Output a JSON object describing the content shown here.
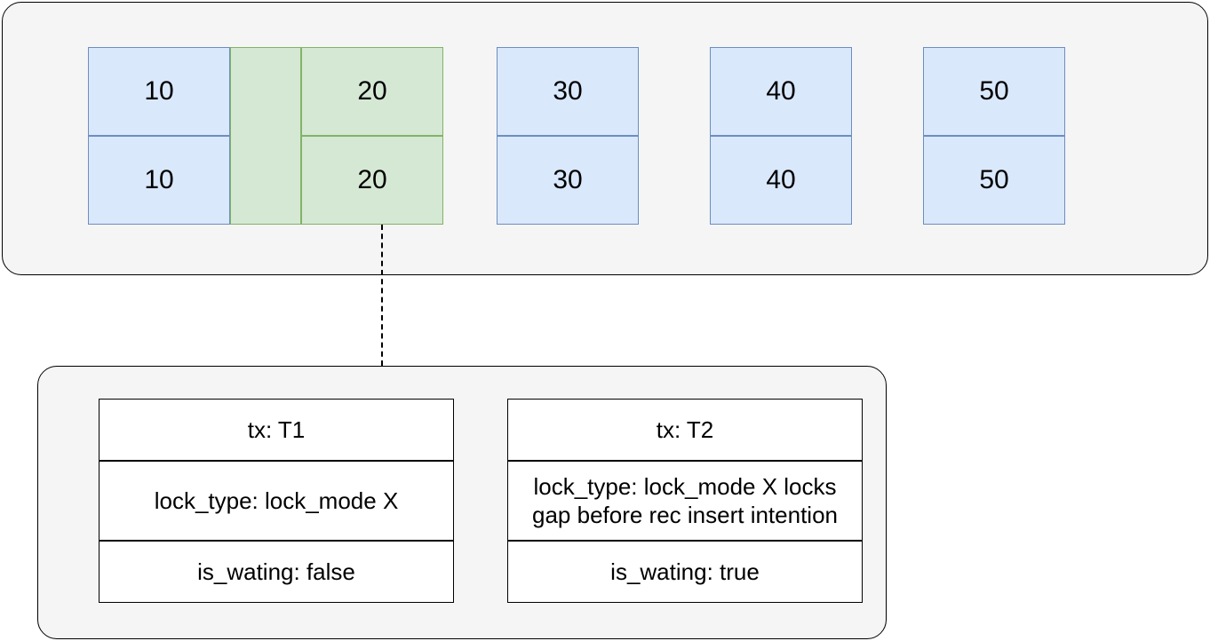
{
  "colors": {
    "blue_fill": "#dae8fc",
    "blue_border": "#6c8ebf",
    "green_fill": "#d5e8d4",
    "green_border": "#82b366",
    "container_bg": "#f5f5f5"
  },
  "top": {
    "col1": {
      "top": "10",
      "bottom": "10"
    },
    "gap_node": "",
    "col2": {
      "top": "20",
      "bottom": "20"
    },
    "col3": {
      "top": "30",
      "bottom": "30"
    },
    "col4": {
      "top": "40",
      "bottom": "40"
    },
    "col5": {
      "top": "50",
      "bottom": "50"
    }
  },
  "locks": {
    "t1": {
      "tx": "tx: T1",
      "lock_type": "lock_type: lock_mode X",
      "is_waiting": "is_wating: false"
    },
    "t2": {
      "tx": "tx: T2",
      "lock_type": "lock_type: lock_mode X locks gap before rec insert intention",
      "is_waiting": "is_wating: true"
    }
  }
}
